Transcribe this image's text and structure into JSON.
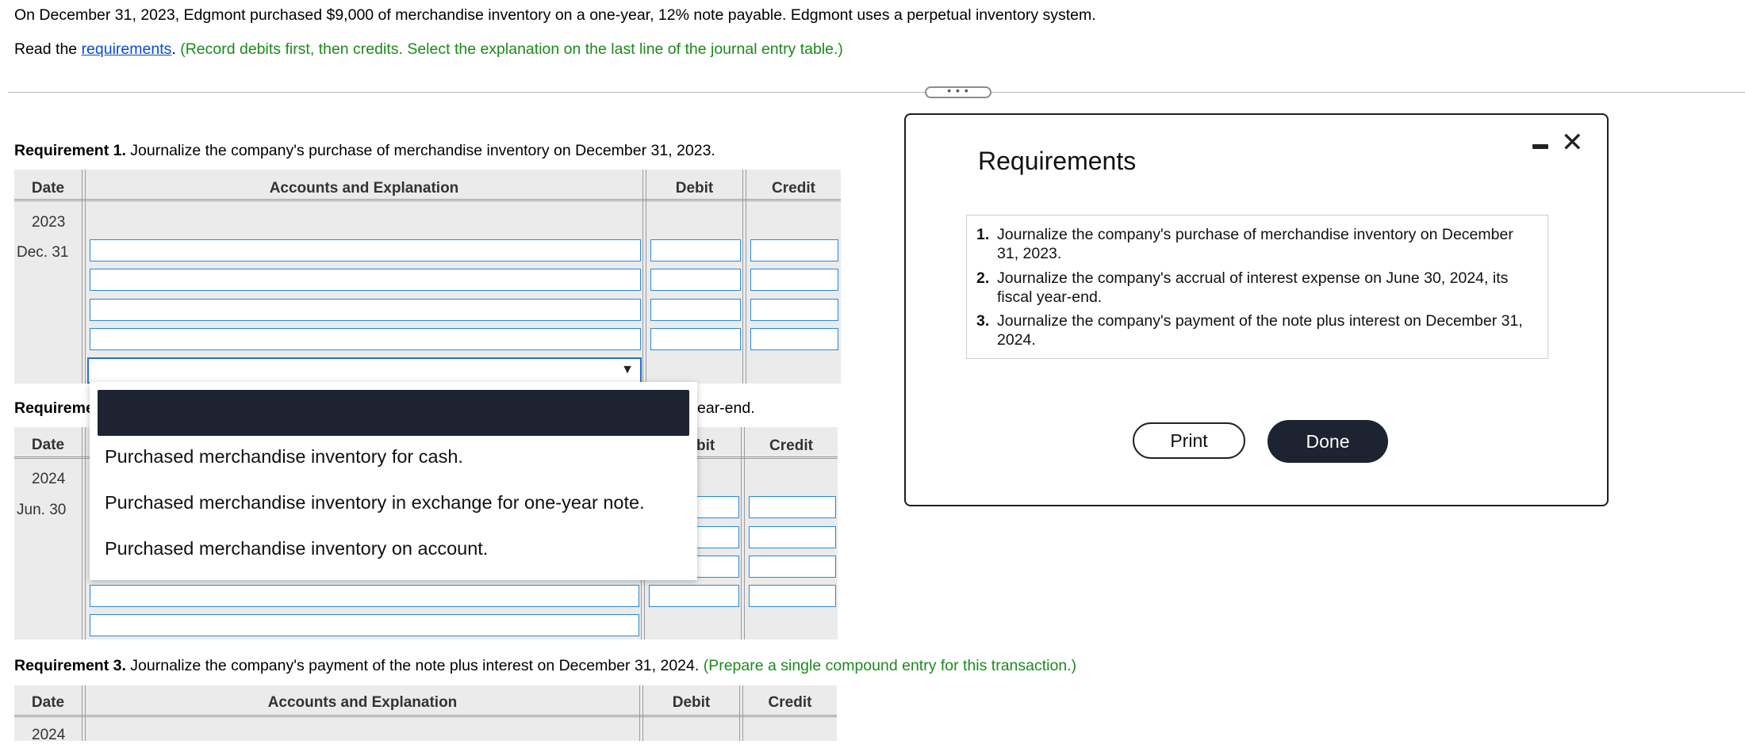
{
  "intro": {
    "line1": "On December 31, 2023, Edgmont purchased $9,000 of merchandise inventory on a one-year, 12% note payable. Edgmont uses a perpetual inventory system.",
    "read_prefix": "Read the ",
    "requirements_link": "requirements",
    "period": ".",
    "instruction": " (Record debits first, then credits. Select the explanation on the last line of the journal entry table.)"
  },
  "divider_handle": "• • •",
  "req1": {
    "label": "Requirement 1.",
    "text": " Journalize the company's purchase of merchandise inventory on December 31, 2023.",
    "headers": {
      "date": "Date",
      "accounts": "Accounts and Explanation",
      "debit": "Debit",
      "credit": "Credit"
    },
    "year": "2023",
    "date": "Dec. 31"
  },
  "req2": {
    "label_visible": "Requireme",
    "text_tail": "ear-end.",
    "headers": {
      "date": "Date",
      "debit_partial": "bit",
      "credit": "Credit"
    },
    "year": "2024",
    "date": "Jun. 30"
  },
  "req3": {
    "label": "Requirement 3.",
    "text": " Journalize the company's payment of the note plus interest on December 31, 2024.",
    "instruction": " (Prepare a single compound entry for this transaction.)",
    "headers": {
      "date": "Date",
      "accounts": "Accounts and Explanation",
      "debit": "Debit",
      "credit": "Credit"
    },
    "year": "2024"
  },
  "select": {
    "arrow": "▼"
  },
  "dropdown": {
    "options": [
      "Purchased merchandise inventory for cash.",
      "Purchased merchandise inventory in exchange for one-year note.",
      "Purchased merchandise inventory on account."
    ]
  },
  "modal": {
    "title": "Requirements",
    "items": [
      {
        "num": "1.",
        "text": "Journalize the company's purchase of merchandise inventory on December 31, 2023."
      },
      {
        "num": "2.",
        "text": "Journalize the company's accrual of interest expense on June 30, 2024, its fiscal year-end."
      },
      {
        "num": "3.",
        "text": "Journalize the company's payment of the note plus interest on December 31, 2024."
      }
    ],
    "print_label": "Print",
    "done_label": "Done",
    "close_glyph": "✕"
  }
}
